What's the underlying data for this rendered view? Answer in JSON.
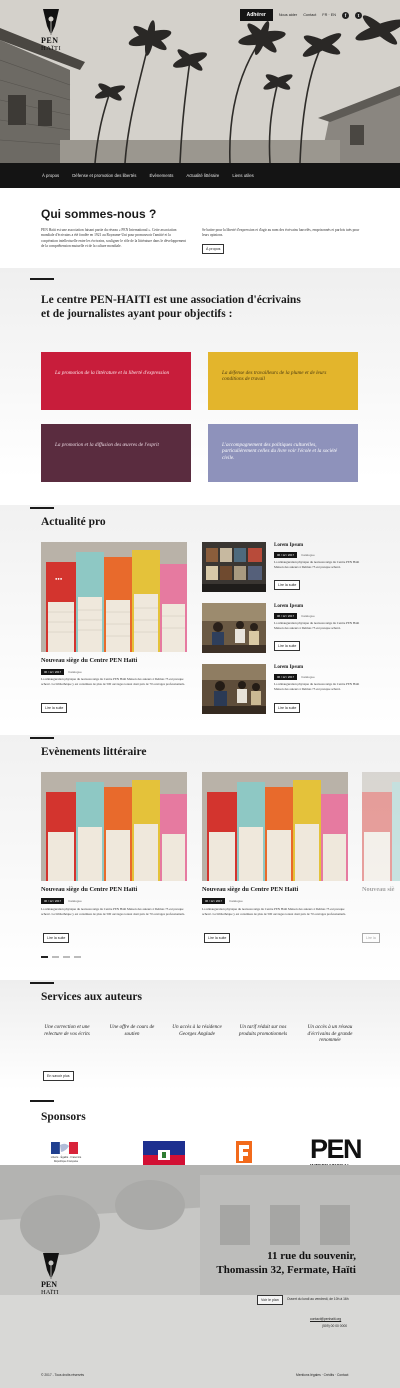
{
  "header": {
    "logo_pen": "PEN",
    "logo_haiti": "HAÏTI",
    "cta": "Adhérer",
    "links": [
      "Nous aider",
      "Contact",
      "FR · EN"
    ],
    "social": [
      "f",
      "t"
    ]
  },
  "nav": [
    "À propos",
    "Défense et promotion des libertés",
    "Évènements",
    "Actualité littéraire",
    "Liens utiles"
  ],
  "about": {
    "title": "Qui sommes-nous ?",
    "text_left": "PEN Haïti est une association faisant partie du réseau « PEN International ». Cette association mondiale d'écrivains a été fondée en 1921 au Royaume-Uni pour promouvoir l'amitié et la coopération intellectuelle entre les écrivains, souligner le rôle de la littérature dans le développement de la compréhension mutuelle et de la culture mondiale.",
    "text_right": "Se battre pour la liberté d'expression et d'agir au nom des écrivains harcelés, emprisonnés et parfois tués pour leurs opinions.",
    "button": "À propos"
  },
  "mission": {
    "title": "Le centre PEN-HAITI est une association d'écrivains et de journalistes ayant pour objectifs :",
    "cards": [
      "La promotion de la littérature et la liberté d'expression",
      "La défense des travailleurs de la plume et de leurs conditions de travail",
      "La promotion et la diffusion des œuvres de l'esprit",
      "L'accompagnement des politiques culturelles, particulièrement celles du livre voir l'école et la société civile."
    ]
  },
  "actualite": {
    "title": "Actualité pro",
    "featured": {
      "title": "Nouveau siège du Centre PEN Haïti",
      "date": "06 / 12 / 2017",
      "category": "Catalogue",
      "text": "La réinauguration physique du nouveau siège du Centre PEN Haïti Maison des auteurs à Delmas 75 est presque achevé. La bibliothèque y est constituée de plus de 500 ouvrages totaux dont près de 70 ouvrages professionnels.",
      "button": "Lire la suite"
    },
    "side": [
      {
        "title": "Lorem Ipsum",
        "date": "06 / 12 / 2017",
        "category": "Catalogue",
        "text": "La réinauguration physique du nouveau siège du Centre PEN Haïti Maison des auteurs à Delmas 75 est presque achevé.",
        "button": "Lire la suite"
      },
      {
        "title": "Lorem Ipsum",
        "date": "06 / 12 / 2017",
        "category": "Catalogue",
        "text": "La réinauguration physique du nouveau siège du Centre PEN Haïti Maison des auteurs à Delmas 75 est presque achevé.",
        "button": "Lire la suite"
      },
      {
        "title": "Lorem Ipsum",
        "date": "06 / 12 / 2017",
        "category": "Catalogue",
        "text": "La réinauguration physique du nouveau siège du Centre PEN Haïti Maison des auteurs à Delmas 75 est presque achevé.",
        "button": "Lire la suite"
      }
    ]
  },
  "evenements": {
    "title": "Evènements littéraire",
    "items": [
      {
        "title": "Nouveau siège du Centre PEN Haïti",
        "date": "06 / 12 / 2017",
        "category": "Catalogue",
        "text": "La réinauguration physique du nouveau siège du Centre PEN Haïti Maison des auteurs à Delmas 75 est presque achevé. La bibliothèque y est constituée de plus de 500 ouvrages totaux dont près de 70 ouvrages professionnels.",
        "button": "Lire la suite"
      },
      {
        "title": "Nouveau siège du Centre PEN Haïti",
        "date": "06 / 12 / 2017",
        "category": "Catalogue",
        "text": "La réinauguration physique du nouveau siège du Centre PEN Haïti Maison des auteurs à Delmas 75 est presque achevé. La bibliothèque y est constituée de plus de 500 ouvrages totaux dont près de 70 ouvrages professionnels.",
        "button": "Lire la suite"
      },
      {
        "title": "Nouveau siè",
        "button": "Lire la"
      }
    ]
  },
  "services": {
    "title": "Services aux auteurs",
    "items": [
      "Une correction et une relecture de vos écrits",
      "Une offre de cours de soutien",
      "Un accès à la résidence Georges Anglade",
      "Un tarif réduit sur nos produits promotionnels",
      "Un accès à un réseau d'écrivains de grande renommée"
    ],
    "button": "En savoir plus"
  },
  "sponsors": {
    "title": "Sponsors",
    "ambassade_line1": "Liberté · Égalité · Fraternité",
    "ambassade_line2": "République Française",
    "ambassade_caption": "Ambassade de France en Haïti",
    "fokal": "fokal",
    "pen_intl": "PEN",
    "pen_intl_sub": "INTERNATIONAL"
  },
  "footer": {
    "address_line1": "11 rue du souvenir,",
    "address_line2": "Thomassin 32, Fermate, Haïti",
    "button": "Voir le plan",
    "hours": "Ouvert du lundi au vendredi, de 10h à 16h",
    "email": "contact@penhaiti.org",
    "phone": "(509) 00 00 0000",
    "copyright": "© 2017 - Tous droits réservés",
    "legal": "Mentions légales · Crédits · Contact"
  },
  "colors": {
    "red": "#c81d3b",
    "yellow": "#e3b52c",
    "plum": "#5a2c3f",
    "lavender": "#8e92bb",
    "dark": "#141414"
  }
}
